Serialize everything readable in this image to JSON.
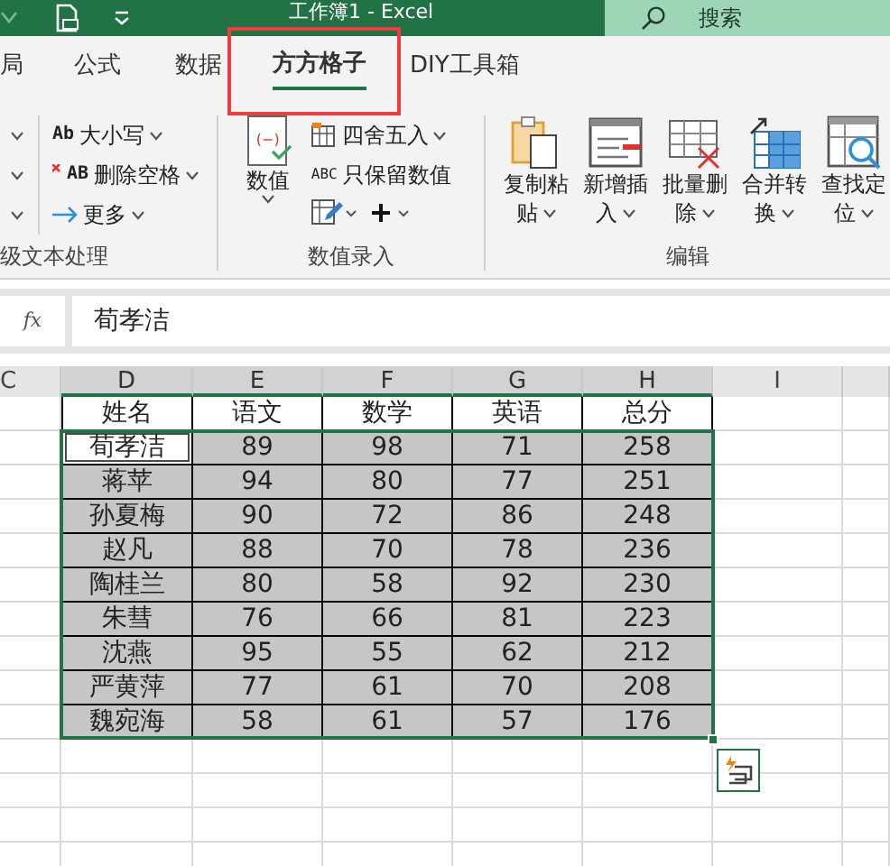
{
  "title_bar": {
    "title": "工作簿1  -  Excel",
    "search_placeholder": "搜索"
  },
  "tabs": [
    {
      "label": "局",
      "selected": false
    },
    {
      "label": "公式",
      "selected": false
    },
    {
      "label": "数据",
      "selected": false
    },
    {
      "label": "方方格子",
      "selected": true,
      "highlighted": true
    },
    {
      "label": "DIY工具箱",
      "selected": false
    }
  ],
  "ribbon": {
    "text_group": {
      "label": "级文本处理",
      "dropdowns": [
        {
          "kind": "dropdown"
        },
        {
          "kind": "dropdown"
        },
        {
          "kind": "dropdown"
        }
      ],
      "items": [
        {
          "kind": "ab",
          "icon_text": "Ab",
          "label": "大小写"
        },
        {
          "kind": "delete",
          "icon_text": "AB",
          "label": "删除空格"
        },
        {
          "kind": "more",
          "label": "更多"
        }
      ]
    },
    "number_group": {
      "label": "数值录入",
      "big_button": {
        "icon_text": "(−)",
        "label": "数值"
      },
      "items": [
        {
          "kind": "round",
          "label": "四舍五入"
        },
        {
          "kind": "abc",
          "icon_text": "ABC",
          "label": "只保留数值"
        }
      ]
    },
    "edit_group": {
      "label": "编辑",
      "buttons": [
        {
          "kind": "paste",
          "label": "复制粘贴"
        },
        {
          "kind": "insert",
          "label": "新增插入"
        },
        {
          "kind": "delete",
          "label": "批量删除"
        },
        {
          "kind": "merge",
          "label": "合并转换"
        },
        {
          "kind": "find",
          "label": "查找定位"
        }
      ]
    }
  },
  "formula_bar": {
    "function_label": "fx",
    "value": "荀孝洁"
  },
  "sheet": {
    "columns": [
      {
        "label": "C",
        "selected": false
      },
      {
        "label": "D",
        "selected": true
      },
      {
        "label": "E",
        "selected": true
      },
      {
        "label": "F",
        "selected": true
      },
      {
        "label": "G",
        "selected": true
      },
      {
        "label": "H",
        "selected": true
      },
      {
        "label": "I",
        "selected": false
      }
    ],
    "rows": [
      {
        "selected": false,
        "active": false,
        "cells": [
          "",
          "姓名",
          "语文",
          "数学",
          "英语",
          "总分",
          ""
        ]
      },
      {
        "selected": true,
        "active": true,
        "cells": [
          "",
          "荀孝洁",
          "89",
          "98",
          "71",
          "258",
          ""
        ]
      },
      {
        "selected": true,
        "active": false,
        "cells": [
          "",
          "蒋苹",
          "94",
          "80",
          "77",
          "251",
          ""
        ]
      },
      {
        "selected": true,
        "active": false,
        "cells": [
          "",
          "孙夏梅",
          "90",
          "72",
          "86",
          "248",
          ""
        ]
      },
      {
        "selected": true,
        "active": false,
        "cells": [
          "",
          "赵凡",
          "88",
          "70",
          "78",
          "236",
          ""
        ]
      },
      {
        "selected": true,
        "active": false,
        "cells": [
          "",
          "陶桂兰",
          "80",
          "58",
          "92",
          "230",
          ""
        ]
      },
      {
        "selected": true,
        "active": false,
        "cells": [
          "",
          "朱彗",
          "76",
          "66",
          "81",
          "223",
          ""
        ]
      },
      {
        "selected": true,
        "active": false,
        "cells": [
          "",
          "沈燕",
          "95",
          "55",
          "62",
          "212",
          ""
        ]
      },
      {
        "selected": true,
        "active": false,
        "cells": [
          "",
          "严黄萍",
          "77",
          "61",
          "70",
          "208",
          ""
        ]
      },
      {
        "selected": true,
        "active": false,
        "cells": [
          "",
          "魏宛海",
          "58",
          "61",
          "57",
          "176",
          ""
        ]
      }
    ]
  }
}
